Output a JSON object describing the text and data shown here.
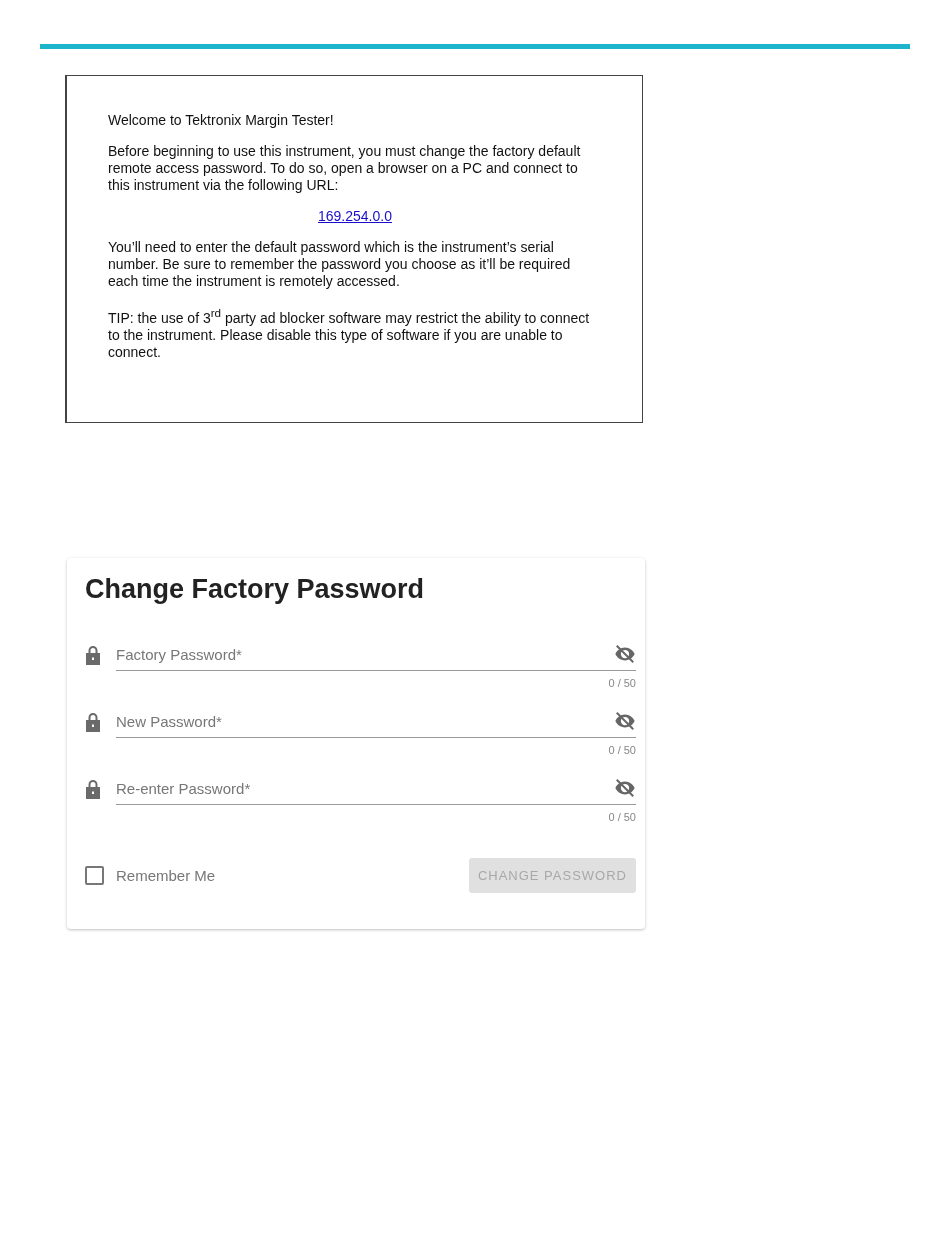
{
  "message_box": {
    "blocks": [
      {
        "kind": "text",
        "text": "Welcome to Tektronix Margin Tester!"
      },
      {
        "kind": "text",
        "text": "Before beginning to use this instrument, you must change the factory default remote access password.  To do so, open a browser on a PC and connect to this instrument via the following URL:"
      },
      {
        "kind": "link",
        "text": "169.254.0.0"
      },
      {
        "kind": "text",
        "text": "You’ll need to enter the default password which is the instrument’s serial number.  Be sure to remember the password you choose as it’ll be required each time the instrument is remotely accessed."
      },
      {
        "kind": "text",
        "text": "TIP:  the use of 3$^{rd}$ party ad blocker software may restrict the ability to connect to the instrument.  Please disable this type of software if you are unable to connect."
      }
    ]
  },
  "password_card": {
    "title": "Change Factory Password",
    "fields": [
      {
        "label": "Factory Password*",
        "counter": "0 / 50",
        "password_hidden": true
      },
      {
        "label": "New Password*",
        "counter": "0 / 50",
        "password_hidden": true
      },
      {
        "label": "Re-enter Password*",
        "counter": "0 / 50",
        "password_hidden": true
      }
    ],
    "remember": {
      "label": "Remember Me",
      "checked": false
    },
    "button": {
      "label": "CHANGE PASSWORD",
      "disabled": true
    }
  }
}
